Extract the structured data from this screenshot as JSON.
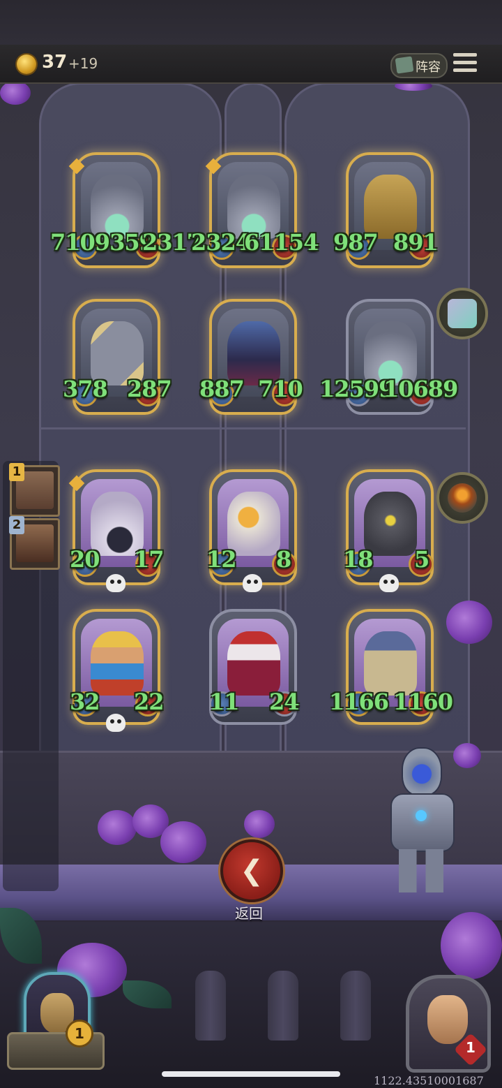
{
  "topbar": {
    "gold": "37",
    "gold_bonus": "+19",
    "lineup_label": "阵容"
  },
  "lineup_slots": [
    {
      "number": "1"
    },
    {
      "number": "2"
    }
  ],
  "cards": [
    {
      "name": "shark-monster",
      "attack": "7109359",
      "health": "2317"
    },
    {
      "name": "shark-monster",
      "attack": "2324",
      "health": "61154"
    },
    {
      "name": "clockwork-robot",
      "attack": "987",
      "health": "891"
    },
    {
      "name": "windmill",
      "attack": "378",
      "health": "287"
    },
    {
      "name": "elf-sorceress",
      "attack": "887",
      "health": "710"
    },
    {
      "name": "shark-monster",
      "attack": "12599",
      "health": "10689"
    },
    {
      "name": "bomb-knight",
      "attack": "20",
      "health": "17"
    },
    {
      "name": "pelican",
      "attack": "12",
      "health": "8"
    },
    {
      "name": "robot-bot",
      "attack": "18",
      "health": "5"
    },
    {
      "name": "pinocchio",
      "attack": "32",
      "health": "22"
    },
    {
      "name": "clown",
      "attack": "11",
      "health": "24"
    },
    {
      "name": "castle",
      "attack": "1166",
      "health": "1160"
    }
  ],
  "back_button": {
    "label": "返回"
  },
  "player_left": {
    "badge": "1"
  },
  "player_right": {
    "lives": "1"
  },
  "build_id": "1122.43510001687",
  "colors": {
    "stat_green": "#7fe07a",
    "back_red": "#c2392e",
    "gold_frame": "#d8ad4e"
  }
}
